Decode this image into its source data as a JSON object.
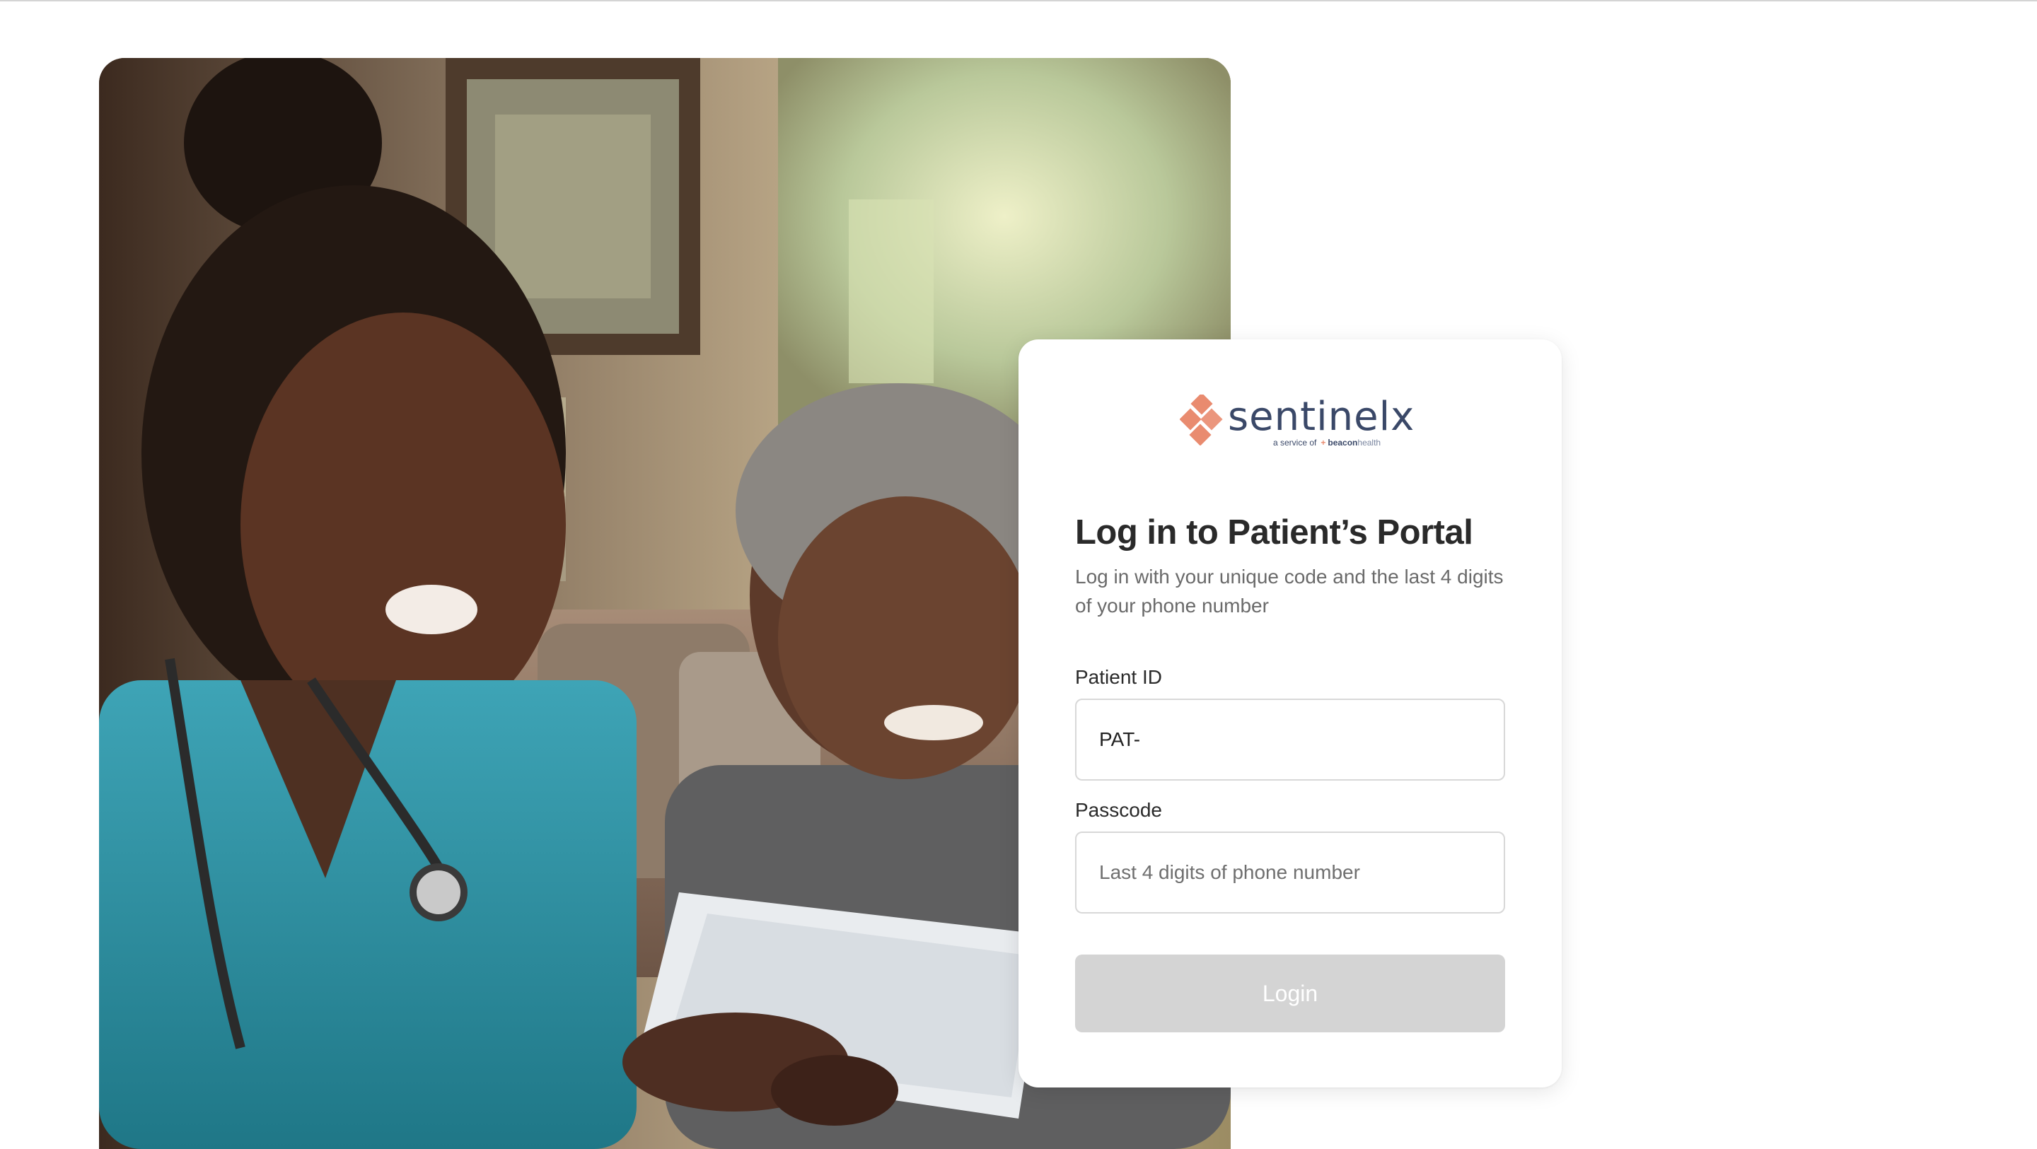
{
  "hero": {
    "alt": "Nurse in teal scrubs smiling with an elderly patient reviewing papers"
  },
  "brand": {
    "name": "sentinelx",
    "tagline_prefix": "a service of",
    "parent_bold": "beacon",
    "parent_light": "health",
    "accent_color": "#e98b6f",
    "text_color": "#3a4868"
  },
  "login": {
    "title": "Log in to Patient’s Portal",
    "subtitle": "Log in with your unique code and the last 4 digits of your phone number",
    "patient_id_label": "Patient ID",
    "patient_id_value": "PAT-",
    "passcode_label": "Passcode",
    "passcode_placeholder": "Last 4 digits of phone number",
    "button_label": "Login",
    "button_color": "#d4d4d4"
  }
}
